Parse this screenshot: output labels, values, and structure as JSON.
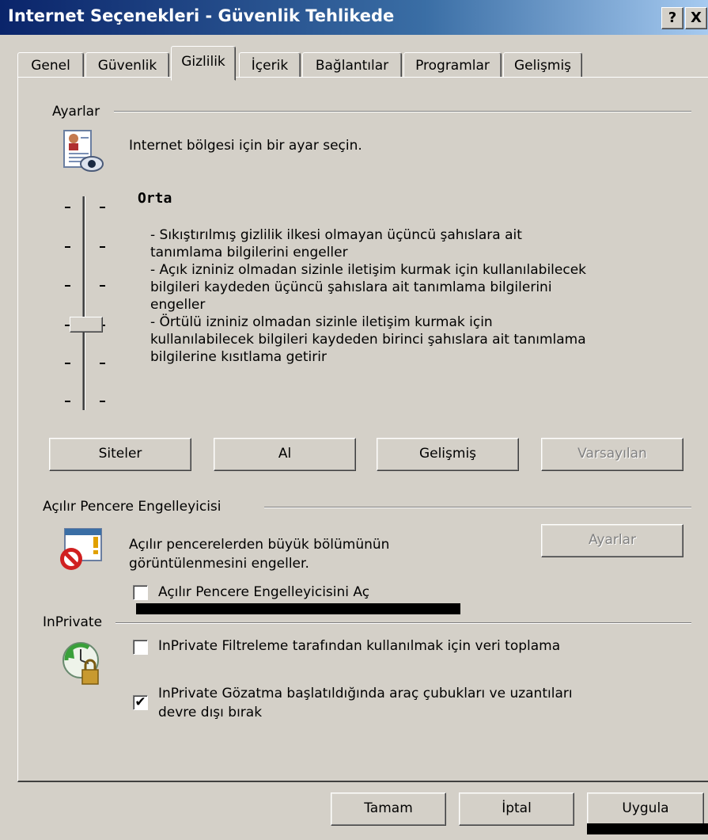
{
  "window": {
    "title": "Internet Seçenekleri - Güvenlik Tehlikede",
    "help_btn": "?",
    "close_btn": "X"
  },
  "tabs": [
    {
      "label": "Genel"
    },
    {
      "label": "Güvenlik"
    },
    {
      "label": "Gizlilik"
    },
    {
      "label": "İçerik"
    },
    {
      "label": "Bağlantılar"
    },
    {
      "label": "Programlar"
    },
    {
      "label": "Gelişmiş"
    }
  ],
  "settings": {
    "group_label": "Ayarlar",
    "instruction": "Internet bölgesi için bir ayar seçin.",
    "level_title": "Orta",
    "slider_level": "Orta",
    "description_lines": [
      "- Sıkıştırılmış gizlilik ilkesi olmayan üçüncü şahıslara ait",
      "tanımlama bilgilerini engeller",
      "- Açık izniniz olmadan sizinle iletişim kurmak için kullanılabilecek",
      "bilgileri kaydeden üçüncü şahıslara ait tanımlama bilgilerini",
      "engeller",
      "- Örtülü izniniz olmadan sizinle iletişim kurmak için",
      "kullanılabilecek bilgileri kaydeden birinci şahıslara ait tanımlama",
      "bilgilerine kısıtlama getirir"
    ],
    "buttons": {
      "sites": "Siteler",
      "import": "Al",
      "advanced": "Gelişmiş",
      "default": "Varsayılan"
    }
  },
  "popup": {
    "group_label": "Açılır Pencere Engelleyicisi",
    "text_line1": "Açılır pencerelerden büyük bölümünün",
    "text_line2": "görüntülenmesini engeller.",
    "settings_btn": "Ayarlar",
    "checkbox_label": "Açılır Pencere Engelleyicisini Aç",
    "checked": false
  },
  "inprivate": {
    "group_label": "InPrivate",
    "filter_label": "InPrivate Filtreleme tarafından kullanılmak için veri toplama",
    "filter_checked": false,
    "browse_label_line1": "InPrivate Gözatma başlatıldığında araç çubukları ve uzantıları",
    "browse_label_line2": "devre dışı bırak",
    "browse_checked": true,
    "check_mark": "✔"
  },
  "footer": {
    "ok": "Tamam",
    "cancel": "İptal",
    "apply": "Uygula"
  }
}
